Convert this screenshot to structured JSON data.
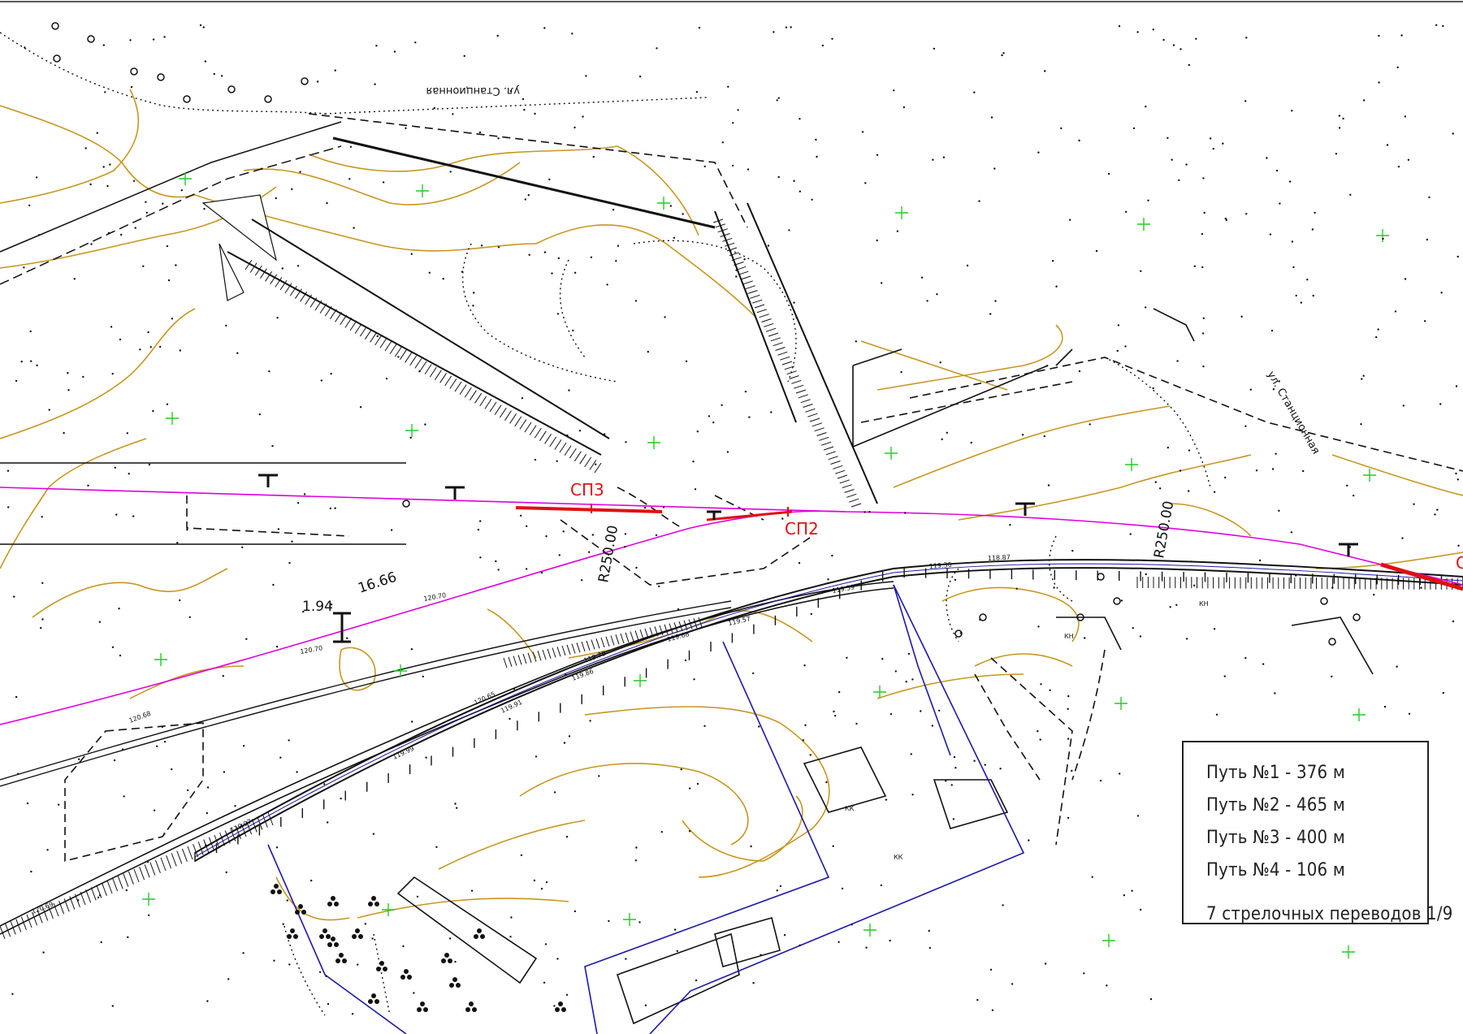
{
  "legend": {
    "rows": [
      "Путь №1  - 376 м",
      "Путь №2  - 465 м",
      "Путь №3  - 400 м",
      "Путь №4  - 106 м"
    ],
    "turnouts": "7 стрелочных переводов 1/9"
  },
  "switch_labels": {
    "sp3": "СП3",
    "sp2": "СП2",
    "sp_partial": "С"
  },
  "radius_labels": {
    "r1": "R250.00",
    "r2": "R250.00"
  },
  "dimensions": {
    "d1": "1.94",
    "d2": "16.66"
  },
  "street_labels": {
    "top": "ул. Станционная",
    "right": "ул. Станционная"
  },
  "elevations": {
    "e1": "120.70",
    "e2": "120.70",
    "e3": "120.65",
    "e4": "120.68",
    "e5": "119.99",
    "e6": "119.91",
    "e7": "119.86",
    "e8": "119.79",
    "e9": "119.68",
    "e10": "119.57",
    "e11": "119.39",
    "e12": "119.36",
    "e13": "118.87",
    "e14": "119.97",
    "e15": "120.69"
  },
  "hatch_labels": {
    "kk1": "КК",
    "kk2": "КК",
    "kk3": "КН",
    "kk4": "КН"
  },
  "colors": {
    "track": "#000000",
    "axis": "#e000e0",
    "switch": "#e01010",
    "contour": "#c8961e",
    "grid_cross": "#22cc22",
    "boundary": "#1a1aa8"
  }
}
